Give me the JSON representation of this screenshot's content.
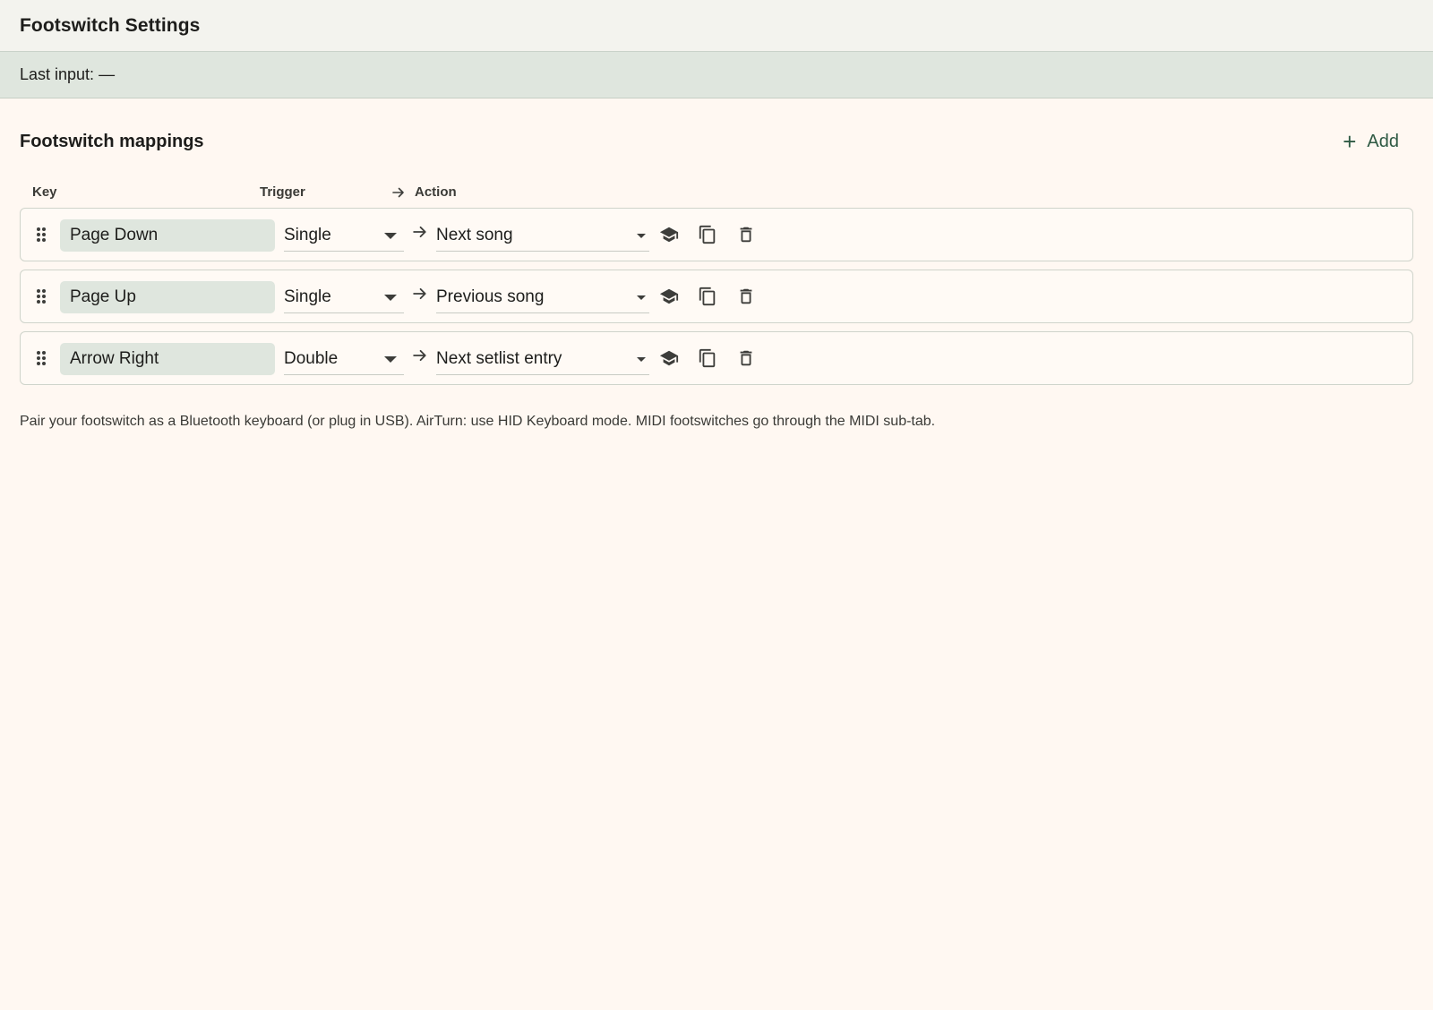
{
  "header": {
    "title": "Footswitch Settings"
  },
  "status": {
    "label": "Last input:",
    "value": "—"
  },
  "section": {
    "title": "Footswitch mappings",
    "add_label": "Add",
    "add_icon": "plus-icon"
  },
  "columns": {
    "key": "Key",
    "trigger": "Trigger",
    "action": "Action"
  },
  "mappings": [
    {
      "key": "Page Down",
      "trigger": "Single",
      "action": "Next song"
    },
    {
      "key": "Page Up",
      "trigger": "Single",
      "action": "Previous song"
    },
    {
      "key": "Arrow Right",
      "trigger": "Double",
      "action": "Next setlist entry"
    }
  ],
  "footnote": "Pair your footswitch as a Bluetooth keyboard (or plug in USB). AirTurn: use HID Keyboard mode. MIDI footswitches go through the MIDI sub-tab.",
  "colors": {
    "background": "#fff8f2",
    "title_bar": "#f3f3ee",
    "status_bar": "#dfe6de",
    "accent": "#2f5a44",
    "icon": "#3d3d3a"
  }
}
